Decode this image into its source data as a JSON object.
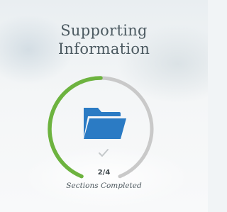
{
  "card": {
    "title_line1": "Supporting",
    "title_line2": "Information"
  },
  "progress": {
    "completed": 2,
    "total": 4,
    "fraction": 0.5,
    "count_text": "2/4",
    "caption": "Sections Completed"
  },
  "icons": {
    "main": "folder-icon",
    "status": "checkmark-icon"
  },
  "colors": {
    "progress_complete": "#6db33f",
    "progress_remaining": "#c9c9c9",
    "folder": "#2b7bc4",
    "text": "#4c5a61"
  }
}
